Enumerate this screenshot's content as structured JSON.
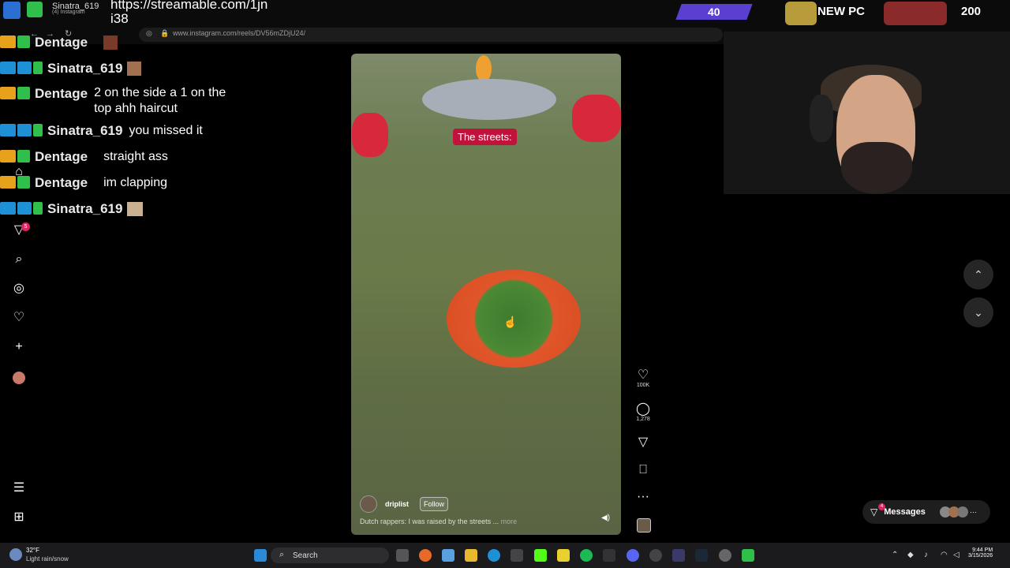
{
  "browser": {
    "tab_title": "Sinatra_619",
    "tab_subtitle": "(4) Instagram",
    "url": "www.instagram.com/reels/DV56mZDjU24/"
  },
  "stream_overlay": {
    "link_text": "https://streamable.com/1jni38",
    "sub_count": "40",
    "new_pc_label": "NEW PC",
    "goal_count": "200"
  },
  "chat": {
    "messages": [
      {
        "user": "Dentage",
        "text": ""
      },
      {
        "user": "Sinatra_619",
        "text": ""
      },
      {
        "user": "Dentage",
        "text": "2 on the side a 1 on the top ahh haircut"
      },
      {
        "user": "Sinatra_619",
        "text": "you missed it"
      },
      {
        "user": "Dentage",
        "text": "straight ass"
      },
      {
        "user": "Dentage",
        "text": "im clapping"
      },
      {
        "user": "Sinatra_619",
        "text": ""
      }
    ]
  },
  "sidebar": {
    "items": [
      {
        "icon": "home-icon"
      },
      {
        "icon": "reels-icon",
        "badge": "5"
      },
      {
        "icon": "search-icon"
      },
      {
        "icon": "explore-icon"
      },
      {
        "icon": "heart-icon"
      },
      {
        "icon": "plus-icon"
      },
      {
        "icon": "profile-icon"
      },
      {
        "icon": "menu-icon"
      },
      {
        "icon": "apps-icon"
      }
    ]
  },
  "reel": {
    "overlay_caption": "The streets:",
    "author": "driplist",
    "follow_label": "Follow",
    "description": "Dutch rappers: I was raised by the streets ...",
    "more_label": "more",
    "likes": "100K",
    "comments": "1,278"
  },
  "messages": {
    "label": "Messages",
    "badge": "4"
  },
  "taskbar": {
    "temperature": "32°F",
    "weather": "Light rain/snow",
    "search_label": "Search",
    "time": "9:44 PM",
    "date": "3/15/2026"
  },
  "colors": {
    "accent": "#c0123a",
    "sub_bar": "#5a3fd0",
    "notification": "#e0245e"
  }
}
